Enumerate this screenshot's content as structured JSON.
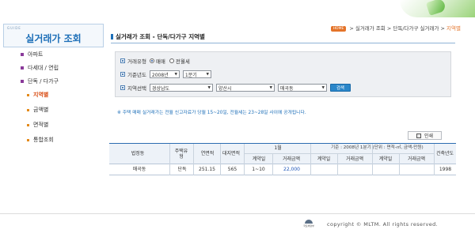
{
  "sidebar": {
    "guide": "GUIDE",
    "title": "실거래가 조회",
    "items": [
      {
        "label": "아파트"
      },
      {
        "label": "다세대 / 연립"
      },
      {
        "label": "단독 / 다가구"
      }
    ],
    "subitems": [
      {
        "label": "지역별"
      },
      {
        "label": "금액별"
      },
      {
        "label": "면적별"
      },
      {
        "label": "통합조회"
      }
    ]
  },
  "breadcrumb": {
    "home": "HOME",
    "path": "> 실거래가 조회 > 단독/다가구 실거래가 >",
    "current": "지역별"
  },
  "page_title": "실거래가 조회 - 단독/다가구 지역별",
  "search": {
    "type_label": "거래유형",
    "type_options": [
      "매매",
      "전월세"
    ],
    "period_label": "기준년도",
    "year": "2008년",
    "quarter": "1분기",
    "region_label": "지역선택",
    "province": "경상남도",
    "city": "양산시",
    "dong": "매곡동",
    "search_button": "검색"
  },
  "notice": "※ 주택 매매 실거래가는 전월 신고자료가 당월 15~20일, 전월세는 23~28일 사이에 공개됩니다.",
  "print_label": "인쇄",
  "table": {
    "caption": "기준 : 2008년 1분기  (단위 : 면적-㎡, 금액-만원)",
    "headers": {
      "dong": "법정동",
      "type": "주택유형",
      "floor_area": "연면적",
      "land_area": "대지면적",
      "month1": "1월",
      "contract_day": "계약일",
      "price": "거래금액",
      "built_year": "건축년도"
    },
    "rows": [
      {
        "dong": "매곡동",
        "type": "단독",
        "floor_area": "251.15",
        "land_area": "565",
        "contract_day": "1~10",
        "price": "22,000",
        "built_year": "1998"
      }
    ]
  },
  "footer": {
    "logo_text": "국토해양부",
    "copyright": "copyright © MLTM. All rights reserved."
  }
}
